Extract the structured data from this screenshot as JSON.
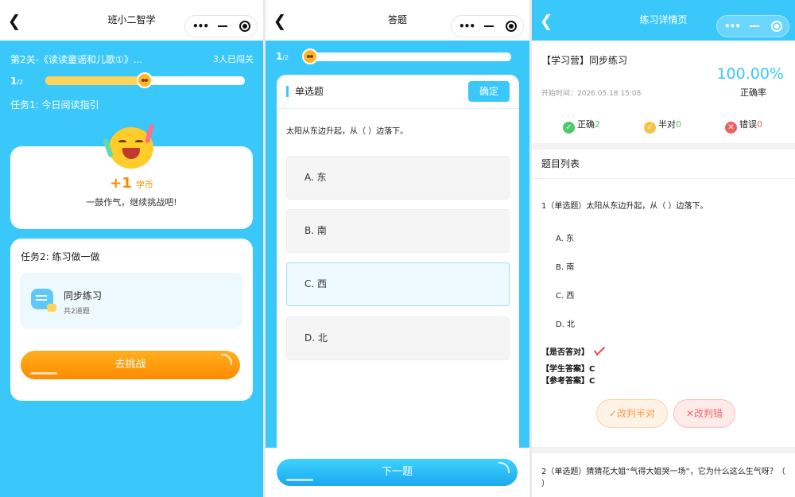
{
  "pane1": {
    "nav_title": "班小二智学",
    "level_title": "第2关-《读读童谣和儿歌①》...",
    "passed_count": "3人已闯关",
    "progress_current": "1",
    "progress_total": "/2",
    "progress_fraction": 0.5,
    "task1_label": "任务1: 今日阅读指引",
    "coin_plus": "+1",
    "coin_unit": "学币",
    "cheer_text": "一鼓作气，继续挑战吧!",
    "task2_label": "任务2: 练习做一做",
    "exercise_title": "同步练习",
    "exercise_sub": "共2道题",
    "challenge_button": "去挑战"
  },
  "pane2": {
    "nav_title": "答题",
    "progress_current": "1",
    "progress_total": "/2",
    "question_type": "单选题",
    "confirm_button": "确定",
    "question_text": "太阳从东边升起，从（ ）边落下。",
    "options": [
      "A. 东",
      "B. 南",
      "C. 西",
      "D. 北"
    ],
    "selected_index": 2,
    "next_button": "下一题"
  },
  "pane3": {
    "nav_title": "练习详情页",
    "practice_title": "【学习营】同步练习",
    "start_time": "开始时间：2026.05.18 15:08",
    "accuracy_value": "100.00%",
    "accuracy_label": "正确率",
    "correct_label": "正确",
    "correct_count": "2",
    "half_label": "半对",
    "half_count": "0",
    "wrong_label": "错误",
    "wrong_count": "0",
    "list_title": "题目列表",
    "q1_text": "1（单选题）太阳从东边升起，从（ ）边落下。",
    "q1_options": [
      "A. 东",
      "B. 南",
      "C. 西",
      "D. 北"
    ],
    "is_correct_label": "【是否答对】",
    "student_answer": "【学生答案】C",
    "reference_answer": "【参考答案】C",
    "half_button": "改判半对",
    "wrong_button": "改判错",
    "q2_text": "2（单选题）猜猜花大姐“气得大姐哭一场”，它为什么这么生气呀？（ ）",
    "colors": {
      "accent": "#3ac8fb",
      "correct": "#4cc96b",
      "half": "#f6c244",
      "wrong": "#f25f5f"
    }
  }
}
